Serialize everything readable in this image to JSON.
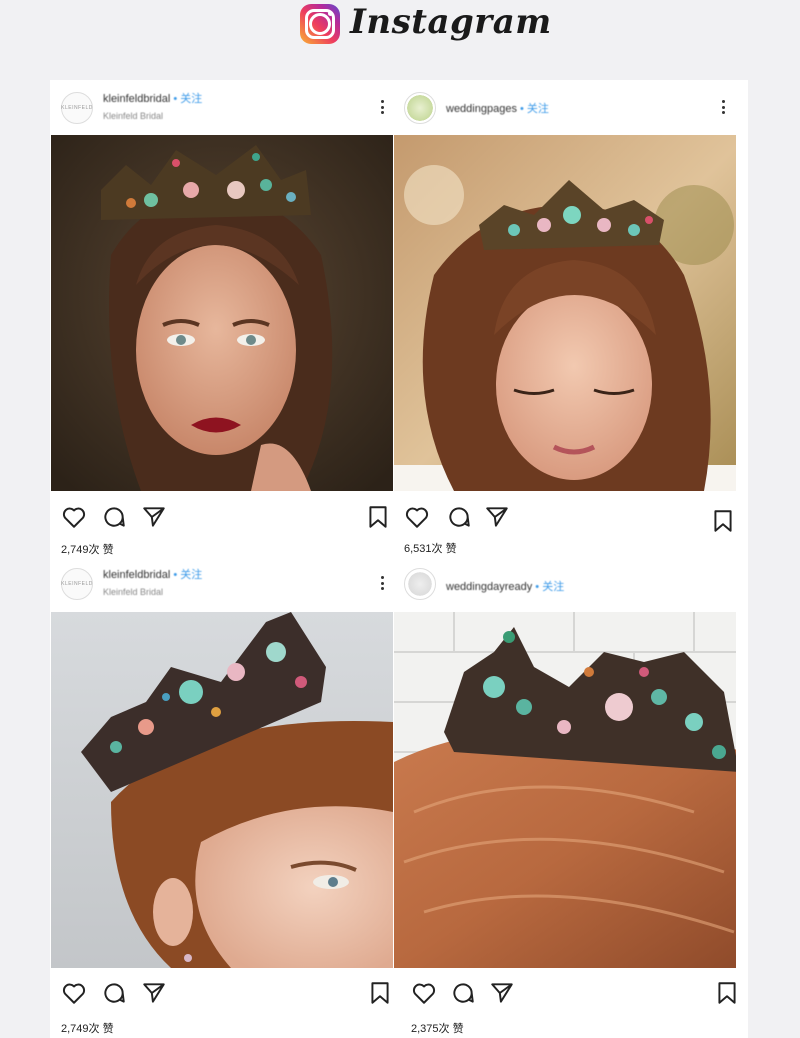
{
  "header": {
    "brand_name": "Instagram",
    "logo_icon": "instagram-logo-icon"
  },
  "posts": [
    {
      "username": "kleinfeldbridal",
      "follow_label": "• 关注",
      "subtitle": "Kleinfeld Bridal",
      "avatar_text": "KLEINFELD",
      "likes": "2,749次 赞",
      "image": "woman-with-jeweled-crown-dark-background"
    },
    {
      "username": "weddingpages",
      "follow_label": "• 关注",
      "subtitle": "",
      "avatar_text": "",
      "likes": "6,531次 赞",
      "image": "smiling-bride-with-crown-outdoors"
    },
    {
      "username": "kleinfeldbridal",
      "follow_label": "• 关注",
      "subtitle": "Kleinfeld Bridal",
      "avatar_text": "KLEINFELD",
      "likes": "2,749次 赞",
      "image": "crown-on-auburn-hair-profile"
    },
    {
      "username": "weddingdayready",
      "follow_label": "• 关注",
      "subtitle": "",
      "avatar_text": "",
      "likes": "2,375次 赞",
      "image": "crown-on-auburn-hair-tile-wall"
    }
  ],
  "icons": {
    "like": "heart-icon",
    "comment": "comment-icon",
    "share": "send-icon",
    "save": "bookmark-icon",
    "more": "more-options-icon"
  },
  "colors": {
    "follow_blue": "#3d9be9",
    "instagram_gradient": [
      "#f9b233",
      "#ee3d5d",
      "#b32a9c",
      "#5a4fcf"
    ]
  }
}
